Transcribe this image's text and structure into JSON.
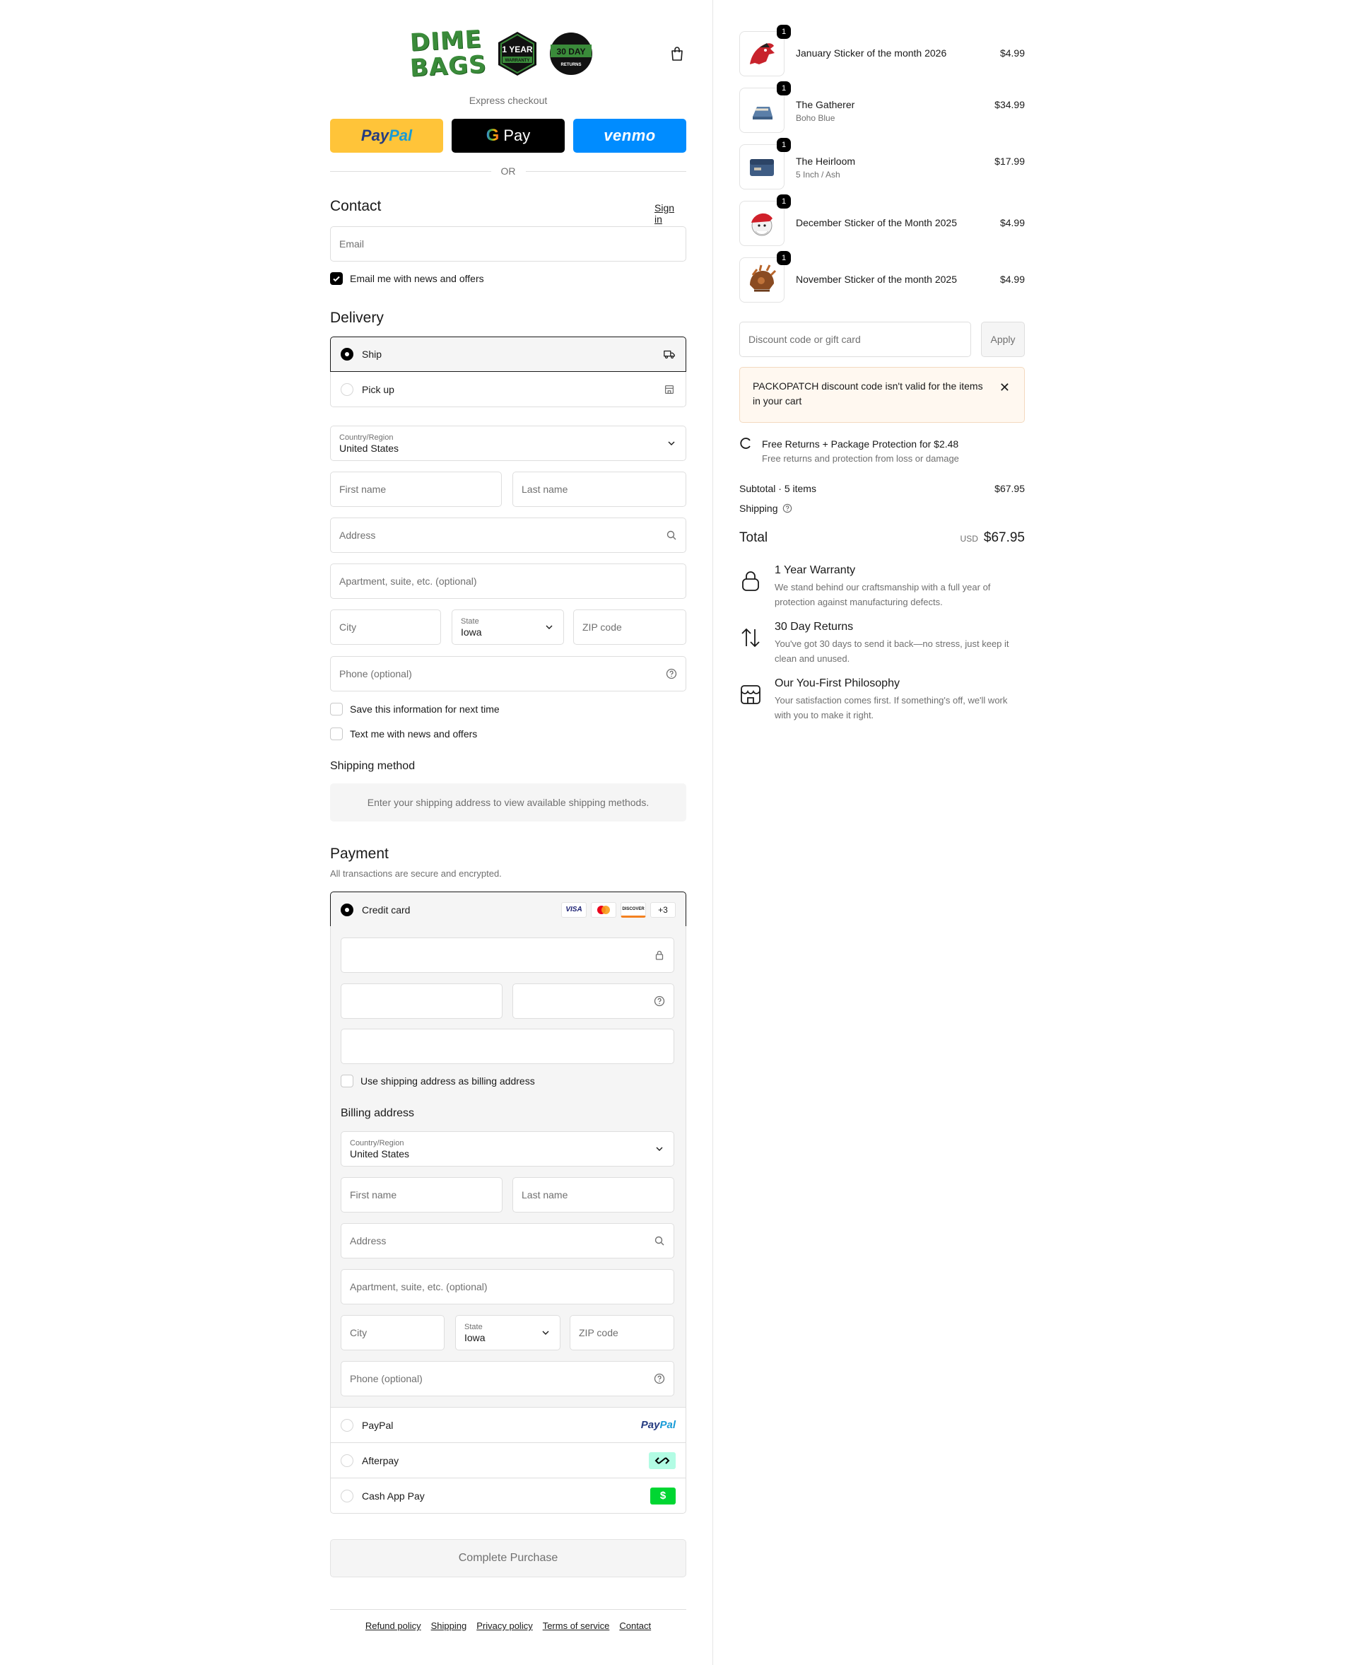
{
  "header": {
    "logo_text_line1": "DIME",
    "logo_text_line2": "BAGS",
    "badge1_top": "1 YEAR",
    "badge1_bottom": "WARRANTY",
    "badge2_top": "30 DAY",
    "badge2_bottom": "RETURNS"
  },
  "express": {
    "label": "Express checkout",
    "paypal_a": "Pay",
    "paypal_b": "Pal",
    "gpay_label": "Pay",
    "venmo_label": "venmo",
    "or_label": "OR"
  },
  "contact": {
    "heading": "Contact",
    "sign_in": "Sign in",
    "email_placeholder": "Email",
    "news_label": "Email me with news and offers"
  },
  "delivery": {
    "heading": "Delivery",
    "ship_label": "Ship",
    "pickup_label": "Pick up",
    "country_label": "Country/Region",
    "country_value": "United States",
    "first_name": "First name",
    "last_name": "Last name",
    "address": "Address",
    "apartment": "Apartment, suite, etc. (optional)",
    "city": "City",
    "state_label": "State",
    "state_value": "Iowa",
    "zip": "ZIP code",
    "phone": "Phone (optional)",
    "save_info": "Save this information for next time",
    "text_me": "Text me with news and offers"
  },
  "shipping_method": {
    "heading": "Shipping method",
    "message": "Enter your shipping address to view available shipping methods."
  },
  "payment": {
    "heading": "Payment",
    "subheading": "All transactions are secure and encrypted.",
    "credit_card_label": "Credit card",
    "card_logos": [
      "VISA",
      "MC",
      "DISCOVER"
    ],
    "more_cards": "+3",
    "use_shipping": "Use shipping address as billing address",
    "billing_heading": "Billing address",
    "billing": {
      "country_label": "Country/Region",
      "country_value": "United States",
      "first_name": "First name",
      "last_name": "Last name",
      "address": "Address",
      "apartment": "Apartment, suite, etc. (optional)",
      "city": "City",
      "state_label": "State",
      "state_value": "Iowa",
      "zip": "ZIP code",
      "phone": "Phone (optional)"
    },
    "paypal_label": "PayPal",
    "paypal_brand_a": "Pay",
    "paypal_brand_b": "Pal",
    "afterpay_label": "Afterpay",
    "cashapp_label": "Cash App Pay",
    "cashapp_brand": "$"
  },
  "complete_button": "Complete Purchase",
  "footer": [
    "Refund policy",
    "Shipping",
    "Privacy policy",
    "Terms of service",
    "Contact"
  ],
  "cart": {
    "items": [
      {
        "name": "January Sticker of the month 2026",
        "variant": "",
        "price": "$4.99",
        "qty": "1"
      },
      {
        "name": "The Gatherer",
        "variant": "Boho Blue",
        "price": "$34.99",
        "qty": "1"
      },
      {
        "name": "The Heirloom",
        "variant": "5 Inch / Ash",
        "price": "$17.99",
        "qty": "1"
      },
      {
        "name": "December Sticker of the Month 2025",
        "variant": "",
        "price": "$4.99",
        "qty": "1"
      },
      {
        "name": "November Sticker of the month 2025",
        "variant": "",
        "price": "$4.99",
        "qty": "1"
      }
    ],
    "discount_placeholder": "Discount code or gift card",
    "apply_label": "Apply",
    "notice": "PACKOPATCH discount code isn't valid for the items in your cart",
    "protection_title": "Free Returns + Package Protection for $2.48",
    "protection_desc": "Free returns and protection from loss or damage",
    "subtotal_label": "Subtotal · 5 items",
    "subtotal_value": "$67.95",
    "shipping_label": "Shipping",
    "total_label": "Total",
    "currency": "USD",
    "total_value": "$67.95"
  },
  "perks": [
    {
      "title": "1 Year Warranty",
      "desc": "We stand behind our craftsmanship with a full year of protection against manufacturing defects.",
      "icon": "lock-icon"
    },
    {
      "title": "30 Day Returns",
      "desc": "You've got 30 days to send it back—no stress, just keep it clean and unused.",
      "icon": "arrows-up-down-icon"
    },
    {
      "title": "Our You-First Philosophy",
      "desc": "Your satisfaction comes first. If something's off, we'll work with you to make it right.",
      "icon": "storefront-icon"
    }
  ],
  "colors": {
    "accent": "#000000",
    "border": "#dedede",
    "muted": "#707070",
    "panel": "#f5f5f5",
    "logo_green": "#3a8b3a",
    "paypal_yellow": "#ffc439",
    "venmo_blue": "#008cff",
    "notice_bg": "#fff8f0"
  }
}
